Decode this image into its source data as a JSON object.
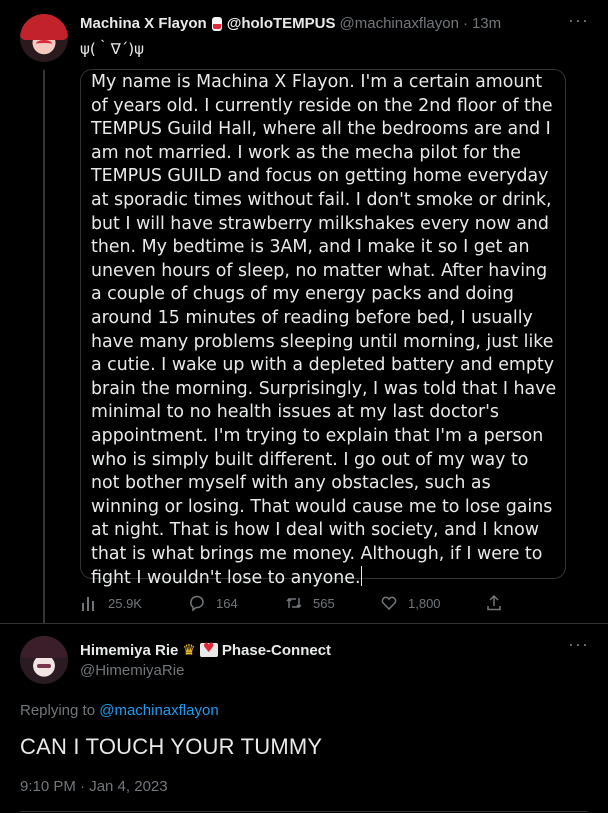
{
  "tweet": {
    "author_name": "Machina X Flayon",
    "badge_icon": "pill-icon",
    "author_suffix": "@holoTEMPUS",
    "handle": "@machinaxflayon",
    "separator": "·",
    "time_ago": "13m",
    "kaomoji": "ψ(｀∇´)ψ",
    "body": "My name is Machina X Flayon. I'm a certain amount of years old. I currently reside on the 2nd floor of the TEMPUS Guild Hall, where all the bedrooms are and I am not married. I work as the mecha pilot for the TEMPUS GUILD and focus on getting home everyday at sporadic times without fail. I don't smoke or drink, but I will have strawberry milkshakes every now and then. My bedtime is 3AM, and I make it so I get an uneven hours of sleep, no matter what. After having a couple of chugs of my energy packs and doing around 15 minutes of reading before bed, I usually have many problems sleeping until morning, just like a cutie. I wake up with a depleted battery and empty brain the morning. Surprisingly, I was told that I have minimal to no health issues at my last doctor's appointment. I'm trying to explain that I'm a person who is simply built different. I go out of my way to not bother myself with any obstacles, such as winning or losing. That would cause me to lose gains at night. That is how I deal with society, and I know that is what brings me money. Although, if I were to fight I wouldn't lose to anyone.",
    "more_label": "···",
    "stats": {
      "views": "25.9K",
      "replies": "164",
      "retweets": "565",
      "likes": "1,800"
    }
  },
  "reply": {
    "author_name": "Himemiya Rie",
    "crown_icon": "crown-icon",
    "heart_icon": "heart-letter-icon",
    "author_suffix": "Phase-Connect",
    "handle": "@HimemiyaRie",
    "replying_prefix": "Replying to",
    "replying_handle": "@machinaxflayon",
    "text": "CAN I TOUCH YOUR TUMMY",
    "timestamp": "9:10 PM · Jan 4, 2023",
    "more_label": "···"
  },
  "colors": {
    "background": "#000000",
    "text": "#e7e9ea",
    "muted": "#71767b",
    "link": "#1d9bf0",
    "border": "#2f3336"
  }
}
